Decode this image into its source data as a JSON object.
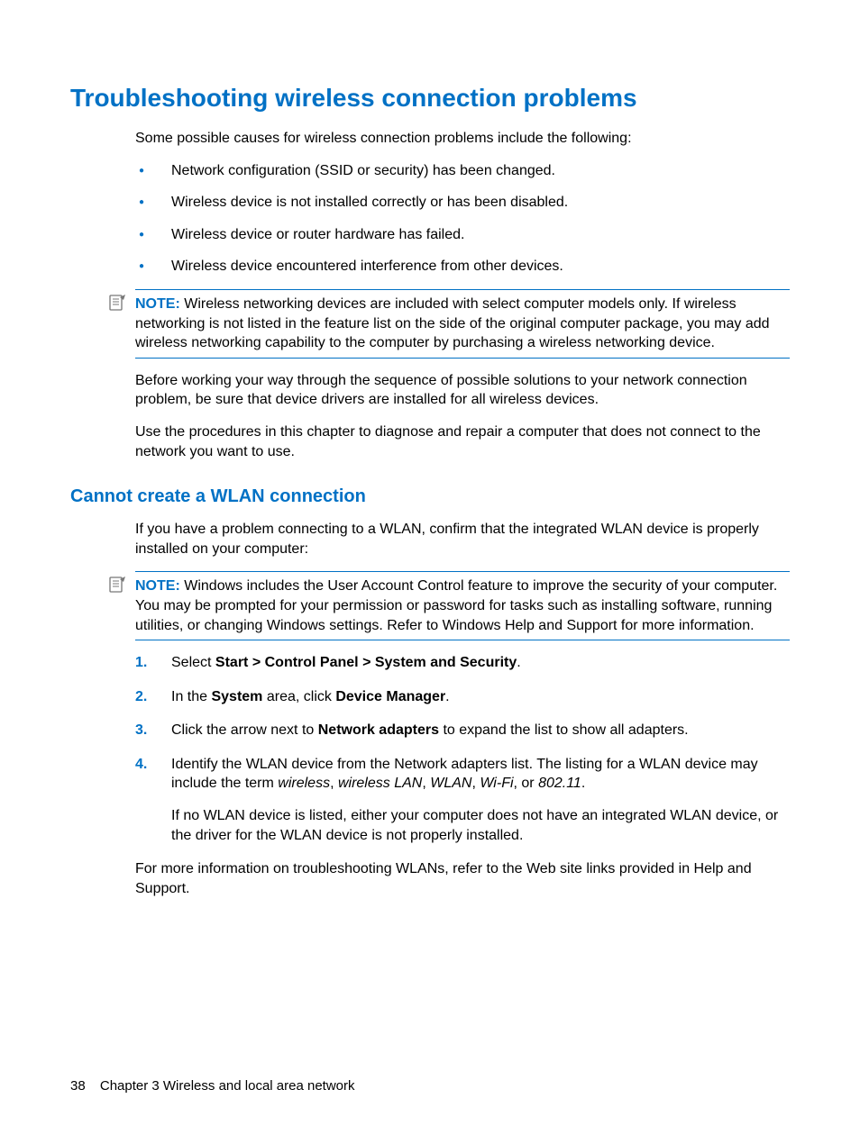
{
  "heading1": "Troubleshooting wireless connection problems",
  "intro": "Some possible causes for wireless connection problems include the following:",
  "causes": [
    "Network configuration (SSID or security) has been changed.",
    "Wireless device is not installed correctly or has been disabled.",
    "Wireless device or router hardware has failed.",
    "Wireless device encountered interference from other devices."
  ],
  "note1_label": "NOTE:",
  "note1_body": "Wireless networking devices are included with select computer models only. If wireless networking is not listed in the feature list on the side of the original computer package, you may add wireless networking capability to the computer by purchasing a wireless networking device.",
  "para_before": "Before working your way through the sequence of possible solutions to your network connection problem, be sure that device drivers are installed for all wireless devices.",
  "para_use": "Use the procedures in this chapter to diagnose and repair a computer that does not connect to the network you want to use.",
  "heading2": "Cannot create a WLAN connection",
  "wlan_intro": "If you have a problem connecting to a WLAN, confirm that the integrated WLAN device is properly installed on your computer:",
  "note2_label": "NOTE:",
  "note2_body": "Windows includes the User Account Control feature to improve the security of your computer. You may be prompted for your permission or password for tasks such as installing software, running utilities, or changing Windows settings. Refer to Windows Help and Support for more information.",
  "steps": {
    "s1_a": "Select ",
    "s1_b": "Start > Control Panel > System and Security",
    "s1_c": ".",
    "s2_a": "In the ",
    "s2_b": "System",
    "s2_c": " area, click ",
    "s2_d": "Device Manager",
    "s2_e": ".",
    "s3_a": "Click the arrow next to ",
    "s3_b": "Network adapters",
    "s3_c": " to expand the list to show all adapters.",
    "s4_a": "Identify the WLAN device from the Network adapters list. The listing for a WLAN device may include the term ",
    "s4_i1": "wireless",
    "s4_s1": ", ",
    "s4_i2": "wireless LAN",
    "s4_s2": ", ",
    "s4_i3": "WLAN",
    "s4_s3": ", ",
    "s4_i4": "Wi-Fi",
    "s4_s4": ", or ",
    "s4_i5": "802.11",
    "s4_s5": ".",
    "s4_p2": "If no WLAN device is listed, either your computer does not have an integrated WLAN device, or the driver for the WLAN device is not properly installed."
  },
  "num": {
    "n1": "1.",
    "n2": "2.",
    "n3": "3.",
    "n4": "4."
  },
  "more_info": "For more information on troubleshooting WLANs, refer to the Web site links provided in Help and Support.",
  "footer": {
    "page": "38",
    "chapter": "Chapter 3   Wireless and local area network"
  }
}
